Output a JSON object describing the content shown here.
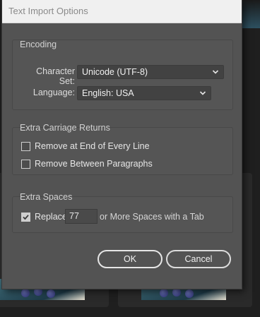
{
  "dialog": {
    "title": "Text Import Options"
  },
  "encoding": {
    "group_label": "Encoding",
    "character_set_label": "Character Set:",
    "character_set_value": "Unicode (UTF-8)",
    "language_label": "Language:",
    "language_value": "English: USA"
  },
  "carriage_returns": {
    "group_label": "Extra Carriage Returns",
    "remove_end_of_line_label": "Remove at End of Every Line",
    "remove_end_of_line_checked": false,
    "remove_between_paragraphs_label": "Remove Between Paragraphs",
    "remove_between_paragraphs_checked": false
  },
  "extra_spaces": {
    "group_label": "Extra Spaces",
    "replace_label": "Replace",
    "replace_checked": true,
    "spaces_value": "77",
    "suffix_label": "or More Spaces with a Tab"
  },
  "buttons": {
    "ok_label": "OK",
    "cancel_label": "Cancel"
  },
  "icons": {
    "dropdown": "chevron-down-icon",
    "checkmark": "checkmark-icon"
  },
  "colors": {
    "dialog_bg": "#535353",
    "titlebar_bg": "#f0f0f0",
    "button_border": "#e6e6e6"
  }
}
